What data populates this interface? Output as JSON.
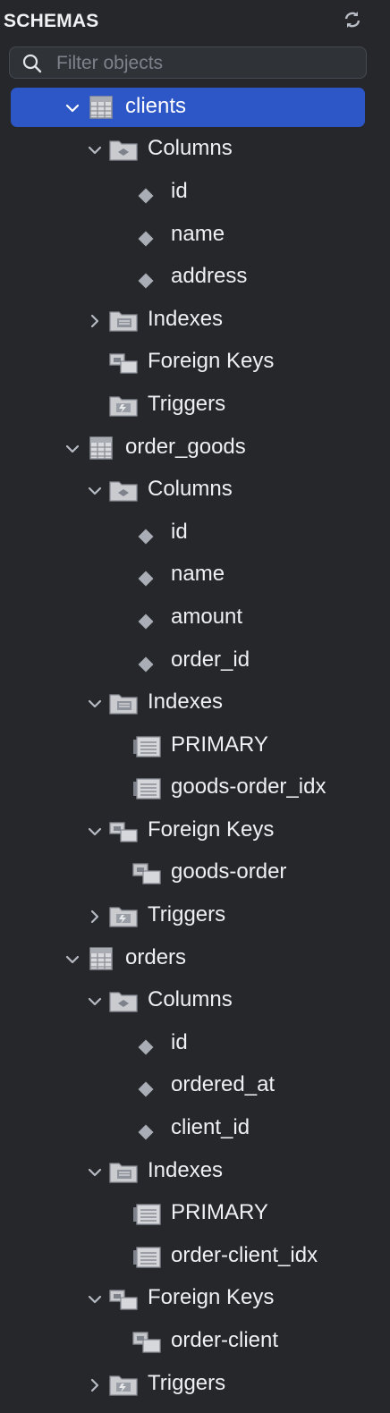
{
  "header": {
    "title": "SCHEMAS"
  },
  "search": {
    "placeholder": "Filter objects"
  },
  "tree": [
    {
      "level": 1,
      "expanded": true,
      "icon": "table",
      "label": "clients",
      "selected": true
    },
    {
      "level": 2,
      "expanded": true,
      "icon": "columns",
      "label": "Columns"
    },
    {
      "level": 3,
      "icon": "column",
      "label": "id"
    },
    {
      "level": 3,
      "icon": "column",
      "label": "name"
    },
    {
      "level": 3,
      "icon": "column",
      "label": "address"
    },
    {
      "level": 2,
      "expanded": false,
      "icon": "indexes",
      "label": "Indexes"
    },
    {
      "level": 2,
      "icon": "foreign-keys",
      "label": "Foreign Keys"
    },
    {
      "level": 2,
      "icon": "triggers",
      "label": "Triggers"
    },
    {
      "level": 1,
      "expanded": true,
      "icon": "table",
      "label": "order_goods"
    },
    {
      "level": 2,
      "expanded": true,
      "icon": "columns",
      "label": "Columns"
    },
    {
      "level": 3,
      "icon": "column",
      "label": "id"
    },
    {
      "level": 3,
      "icon": "column",
      "label": "name"
    },
    {
      "level": 3,
      "icon": "column",
      "label": "amount"
    },
    {
      "level": 3,
      "icon": "column",
      "label": "order_id"
    },
    {
      "level": 2,
      "expanded": true,
      "icon": "indexes",
      "label": "Indexes"
    },
    {
      "level": 3,
      "icon": "index",
      "label": "PRIMARY"
    },
    {
      "level": 3,
      "icon": "index",
      "label": "goods-order_idx"
    },
    {
      "level": 2,
      "expanded": true,
      "icon": "foreign-keys",
      "label": "Foreign Keys"
    },
    {
      "level": 3,
      "icon": "foreign-key",
      "label": "goods-order"
    },
    {
      "level": 2,
      "expanded": false,
      "icon": "triggers",
      "label": "Triggers"
    },
    {
      "level": 1,
      "expanded": true,
      "icon": "table",
      "label": "orders"
    },
    {
      "level": 2,
      "expanded": true,
      "icon": "columns",
      "label": "Columns"
    },
    {
      "level": 3,
      "icon": "column",
      "label": "id"
    },
    {
      "level": 3,
      "icon": "column",
      "label": "ordered_at"
    },
    {
      "level": 3,
      "icon": "column",
      "label": "client_id"
    },
    {
      "level": 2,
      "expanded": true,
      "icon": "indexes",
      "label": "Indexes"
    },
    {
      "level": 3,
      "icon": "index",
      "label": "PRIMARY"
    },
    {
      "level": 3,
      "icon": "index",
      "label": "order-client_idx"
    },
    {
      "level": 2,
      "expanded": true,
      "icon": "foreign-keys",
      "label": "Foreign Keys"
    },
    {
      "level": 3,
      "icon": "foreign-key",
      "label": "order-client"
    },
    {
      "level": 2,
      "expanded": false,
      "icon": "triggers",
      "label": "Triggers"
    }
  ]
}
